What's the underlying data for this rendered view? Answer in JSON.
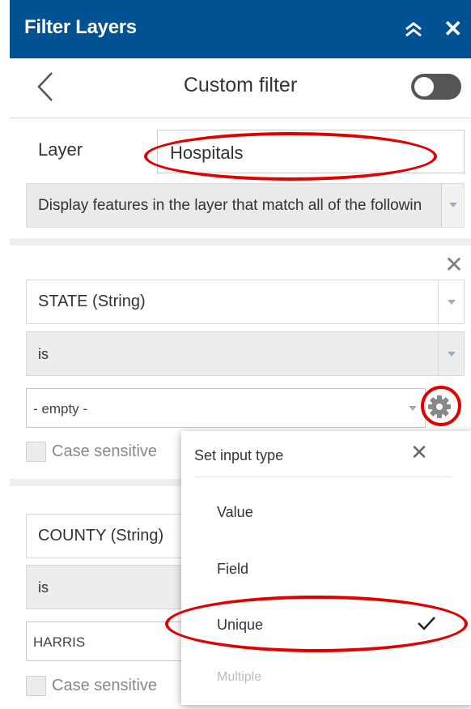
{
  "titlebar": {
    "title": "Filter Layers"
  },
  "header": {
    "title": "Custom filter"
  },
  "layer": {
    "label": "Layer",
    "value": "Hospitals"
  },
  "expression": {
    "text": "Display features in the layer that match all of the followin"
  },
  "filters": [
    {
      "field": "STATE (String)",
      "operator": "is",
      "value": "- empty -",
      "case_label": "Case sensitive"
    },
    {
      "field": "COUNTY (String)",
      "operator": "is",
      "value": "HARRIS",
      "case_label": "Case sensitive"
    }
  ],
  "popup": {
    "title": "Set input type",
    "options": [
      "Value",
      "Field",
      "Unique",
      "Multiple"
    ],
    "selected": "Unique"
  },
  "colors": {
    "titlebar": "#005293",
    "annotation": "#e00000"
  },
  "icons": [
    "collapse-icon",
    "close-icon",
    "back-icon",
    "gear-icon",
    "checkmark-icon"
  ]
}
